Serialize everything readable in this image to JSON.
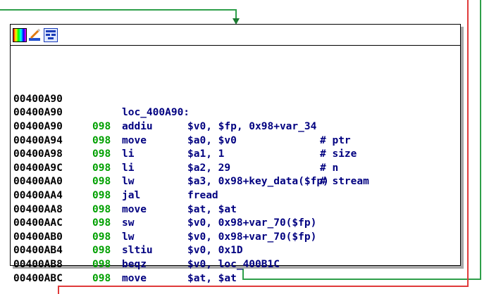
{
  "colors": {
    "node_border": "#000000",
    "node_shadow": "#a8a8a8",
    "address": "#000000",
    "stack_pointer": "#00a000",
    "code": "#000080",
    "edge_green": "#2e9f4a",
    "edge_red": "#e03a3a"
  },
  "titlebar": {
    "icons": [
      "color-palette-icon",
      "edit-node-icon",
      "graph-overview-icon"
    ]
  },
  "listing": {
    "rows": [
      {
        "addr": "00400A90",
        "sp": "",
        "mn": "",
        "ops": "",
        "cm": ""
      },
      {
        "addr": "00400A90",
        "label": "loc_400A90:"
      },
      {
        "addr": "00400A90",
        "sp": "098",
        "mn": "addiu",
        "ops": "$v0, $fp, 0x98+var_34",
        "cm": ""
      },
      {
        "addr": "00400A94",
        "sp": "098",
        "mn": "move",
        "ops": "$a0, $v0",
        "cm": "# ptr"
      },
      {
        "addr": "00400A98",
        "sp": "098",
        "mn": "li",
        "ops": "$a1, 1",
        "cm": "# size"
      },
      {
        "addr": "00400A9C",
        "sp": "098",
        "mn": "li",
        "ops": "$a2, 29",
        "cm": "# n"
      },
      {
        "addr": "00400AA0",
        "sp": "098",
        "mn": "lw",
        "ops": "$a3, 0x98+key_data($fp)",
        "cm": "# stream"
      },
      {
        "addr": "00400AA4",
        "sp": "098",
        "mn": "jal",
        "ops": "fread",
        "cm": ""
      },
      {
        "addr": "00400AA8",
        "sp": "098",
        "mn": "move",
        "ops": "$at, $at",
        "cm": ""
      },
      {
        "addr": "00400AAC",
        "sp": "098",
        "mn": "sw",
        "ops": "$v0, 0x98+var_70($fp)",
        "cm": ""
      },
      {
        "addr": "00400AB0",
        "sp": "098",
        "mn": "lw",
        "ops": "$v0, 0x98+var_70($fp)",
        "cm": ""
      },
      {
        "addr": "00400AB4",
        "sp": "098",
        "mn": "sltiu",
        "ops": "$v0, 0x1D",
        "cm": ""
      },
      {
        "addr": "00400AB8",
        "sp": "098",
        "mn": "beqz",
        "ops": "$v0, loc_400B1C",
        "cm": ""
      },
      {
        "addr": "00400ABC",
        "sp": "098",
        "mn": "move",
        "ops": "$at, $at",
        "cm": ""
      }
    ]
  }
}
